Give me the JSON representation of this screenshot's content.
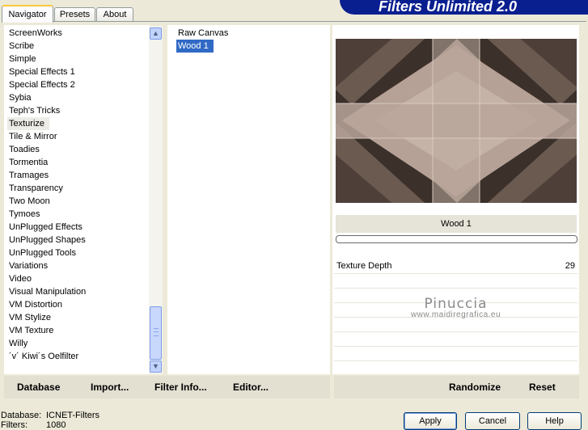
{
  "tabs": [
    {
      "label": "Navigator",
      "active": true
    },
    {
      "label": "Presets",
      "active": false
    },
    {
      "label": "About",
      "active": false
    }
  ],
  "banner_title": "Filters Unlimited 2.0",
  "categories": [
    "ScreenWorks",
    "Scribe",
    "Simple",
    "Special Effects 1",
    "Special Effects 2",
    "Sybia",
    "Teph's Tricks",
    "Texturize",
    "Tile & Mirror",
    "Toadies",
    "Tormentia",
    "Tramages",
    "Transparency",
    "Two Moon",
    "Tymoes",
    "UnPlugged Effects",
    "UnPlugged Shapes",
    "UnPlugged Tools",
    "Variations",
    "Video",
    "Visual Manipulation",
    "VM Distortion",
    "VM Stylize",
    "VM Texture",
    "Willy",
    "´v´ Kiwi´s Oelfilter"
  ],
  "highlighted_category": "Texturize",
  "filters": [
    {
      "label": "Raw Canvas",
      "selected": false
    },
    {
      "label": "Wood 1",
      "selected": true
    }
  ],
  "scrollbar": {
    "up_icon": "▲",
    "down_icon": "▼"
  },
  "preview_filter_name": "Wood 1",
  "slider_param": {
    "label": "Texture Depth",
    "value": "29"
  },
  "watermark": {
    "name": "Pinuccia",
    "url": "www.maidiregrafica.eu"
  },
  "bottom_left": {
    "database": "Database",
    "import": "Import...",
    "filter_info": "Filter Info...",
    "editor": "Editor..."
  },
  "bottom_right": {
    "randomize": "Randomize",
    "reset": "Reset"
  },
  "status": {
    "database_label": "Database:",
    "database_value": "ICNET-Filters",
    "filters_label": "Filters:",
    "filters_value": "1080"
  },
  "buttons": {
    "apply": "Apply",
    "cancel": "Cancel",
    "help": "Help"
  }
}
